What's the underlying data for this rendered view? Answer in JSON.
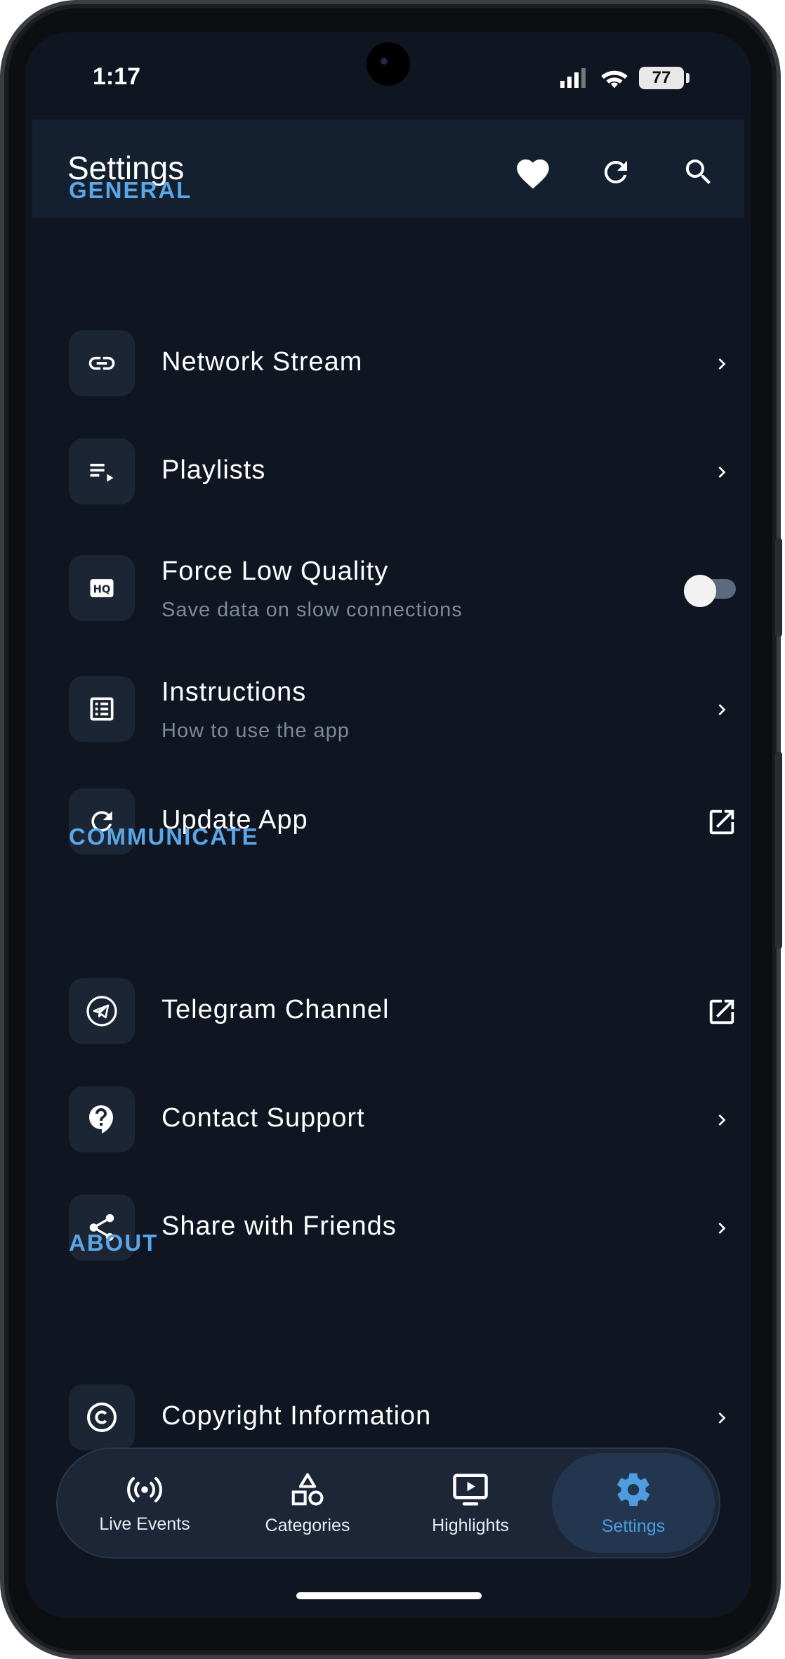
{
  "status_bar": {
    "time": "1:17",
    "battery": "77"
  },
  "app_bar": {
    "title": "Settings",
    "actions": [
      "heart-icon",
      "refresh-icon",
      "search-icon"
    ]
  },
  "sections": {
    "general": {
      "title": "GENERAL",
      "items": [
        {
          "label": "Network Stream",
          "icon": "link-icon",
          "trailing": "chevron-right"
        },
        {
          "label": "Playlists",
          "icon": "playlist-icon",
          "trailing": "chevron-right"
        },
        {
          "label": "Force Low Quality",
          "sublabel": "Save data on slow connections",
          "icon": "hq-icon",
          "trailing": "toggle",
          "toggle_on": false
        },
        {
          "label": "Instructions",
          "sublabel": "How to use the app",
          "icon": "list-icon",
          "trailing": "chevron-right"
        },
        {
          "label": "Update App",
          "icon": "refresh-icon",
          "trailing": "external-link"
        }
      ]
    },
    "communicate": {
      "title": "COMMUNICATE",
      "items": [
        {
          "label": "Telegram Channel",
          "icon": "telegram-icon",
          "trailing": "external-link"
        },
        {
          "label": "Contact Support",
          "icon": "support-icon",
          "trailing": "chevron-right"
        },
        {
          "label": "Share with Friends",
          "icon": "share-icon",
          "trailing": "chevron-right"
        }
      ]
    },
    "about": {
      "title": "ABOUT",
      "items": [
        {
          "label": "Copyright Information",
          "icon": "copyright-icon",
          "trailing": "chevron-right"
        }
      ]
    }
  },
  "bottom_nav": {
    "items": [
      {
        "label": "Live Events",
        "icon": "broadcast-icon",
        "active": false
      },
      {
        "label": "Categories",
        "icon": "shapes-icon",
        "active": false
      },
      {
        "label": "Highlights",
        "icon": "play-screen-icon",
        "active": false
      },
      {
        "label": "Settings",
        "icon": "gear-icon",
        "active": true
      }
    ]
  },
  "colors": {
    "background": "#0f1521",
    "app_bar": "#142030",
    "accent": "#5aa6e6",
    "icon_box": "#1b2533"
  }
}
